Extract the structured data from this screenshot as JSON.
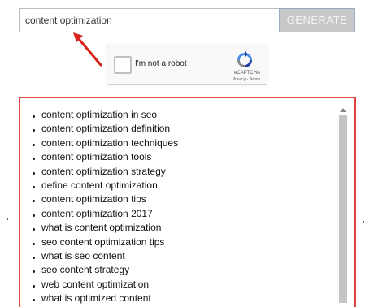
{
  "search": {
    "value": "content optimization",
    "button_label": "GENERATE"
  },
  "recaptcha": {
    "label": "I'm not a robot",
    "brand": "reCAPTCHA",
    "links": "Privacy - Terms"
  },
  "results": [
    "content optimization in seo",
    "content optimization definition",
    "content optimization techniques",
    "content optimization tools",
    "content optimization strategy",
    "define content optimization",
    "content optimization tips",
    "content optimization 2017",
    "what is content optimization",
    "seo content optimization tips",
    "what is seo content",
    "seo content strategy",
    "web content optimization",
    "what is optimized content"
  ],
  "colors": {
    "arrow": "#d9231a",
    "results_border": "#e0463b",
    "button_bg": "#c8c8c8"
  },
  "icons": {
    "arrow": "red-arrow-annotation",
    "captcha": "recaptcha-logo-icon"
  }
}
